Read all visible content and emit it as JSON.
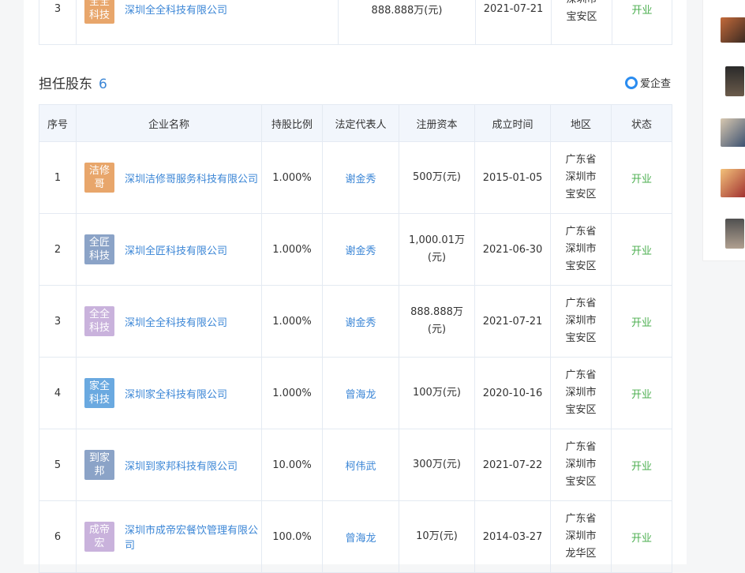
{
  "top_row": {
    "index": "3",
    "logo_text": "全全\n科技",
    "logo_color": "#e8a66b",
    "company": "深圳全全科技有限公司",
    "capital": "888.888万(元)",
    "date": "2021-07-21",
    "area": [
      "深圳市",
      "宝安区"
    ],
    "status": "开业"
  },
  "section": {
    "title": "担任股东",
    "count": "6",
    "brand": "爱企查"
  },
  "headers": [
    "序号",
    "企业名称",
    "持股比例",
    "法定代表人",
    "注册资本",
    "成立时间",
    "地区",
    "状态"
  ],
  "rows": [
    {
      "index": "1",
      "logo_text": "洁修\n哥",
      "logo_color": "#e8a66b",
      "company": "深圳洁修哥服务科技有限公司",
      "ratio": "1.000%",
      "legal": "谢金秀",
      "capital": "500万(元)",
      "date": "2015-01-05",
      "area": [
        "广东省",
        "深圳市",
        "宝安区"
      ],
      "status": "开业"
    },
    {
      "index": "2",
      "logo_text": "全匠\n科技",
      "logo_color": "#8ba3c7",
      "company": "深圳全匠科技有限公司",
      "ratio": "1.000%",
      "legal": "谢金秀",
      "capital": "1,000.01万\n(元)",
      "date": "2021-06-30",
      "area": [
        "广东省",
        "深圳市",
        "宝安区"
      ],
      "status": "开业"
    },
    {
      "index": "3",
      "logo_text": "全全\n科技",
      "logo_color": "#c9b2dc",
      "company": "深圳全全科技有限公司",
      "ratio": "1.000%",
      "legal": "谢金秀",
      "capital": "888.888万\n(元)",
      "date": "2021-07-21",
      "area": [
        "广东省",
        "深圳市",
        "宝安区"
      ],
      "status": "开业"
    },
    {
      "index": "4",
      "logo_text": "家全\n科技",
      "logo_color": "#6aa9e0",
      "company": "深圳家全科技有限公司",
      "ratio": "1.000%",
      "legal": "曾海龙",
      "capital": "100万(元)",
      "date": "2020-10-16",
      "area": [
        "广东省",
        "深圳市",
        "宝安区"
      ],
      "status": "开业"
    },
    {
      "index": "5",
      "logo_text": "到家\n邦",
      "logo_color": "#8ba3c7",
      "company": "深圳到家邦科技有限公司",
      "ratio": "10.00%",
      "legal": "柯伟武",
      "capital": "300万(元)",
      "date": "2021-07-22",
      "area": [
        "广东省",
        "深圳市",
        "宝安区"
      ],
      "status": "开业"
    },
    {
      "index": "6",
      "logo_text": "成帝\n宏",
      "logo_color": "#c9b2dc",
      "company": "深圳市成帝宏餐饮管理有限公司",
      "ratio": "100.0%",
      "legal": "曾海龙",
      "capital": "10万(元)",
      "date": "2014-03-27",
      "area": [
        "广东省",
        "深圳市",
        "龙华区"
      ],
      "status": "开业"
    }
  ]
}
